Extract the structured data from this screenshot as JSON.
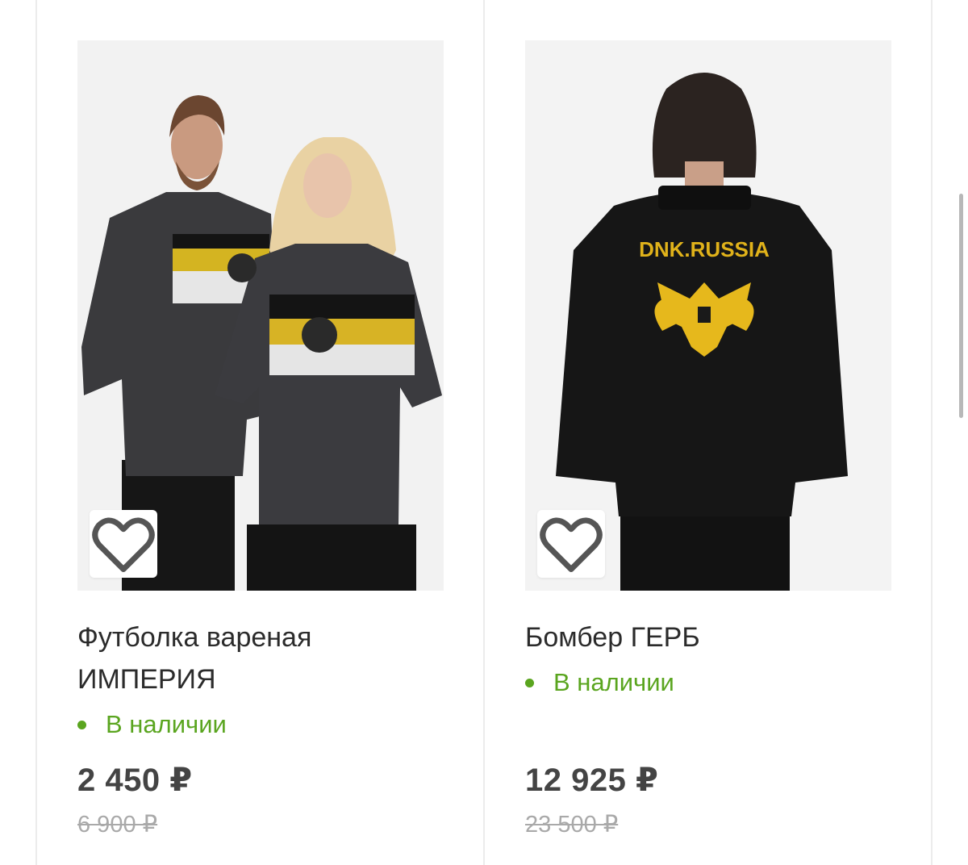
{
  "products": [
    {
      "title_line1": "Футболка вареная",
      "title_line2": "ИМПЕРИЯ",
      "stock": "В наличии",
      "price": "2 450 ₽",
      "old_price": "6 900 ₽",
      "favorite_icon": "heart-icon"
    },
    {
      "title_line1": "Бомбер ГЕРБ",
      "stock": "В наличии",
      "price": "12 925 ₽",
      "old_price": "23 500 ₽",
      "print_text": "DNK.RUSSIA",
      "favorite_icon": "heart-icon"
    }
  ],
  "colors": {
    "in_stock": "#5aa51f",
    "price": "#444444",
    "old_price": "#a9a9a9"
  }
}
